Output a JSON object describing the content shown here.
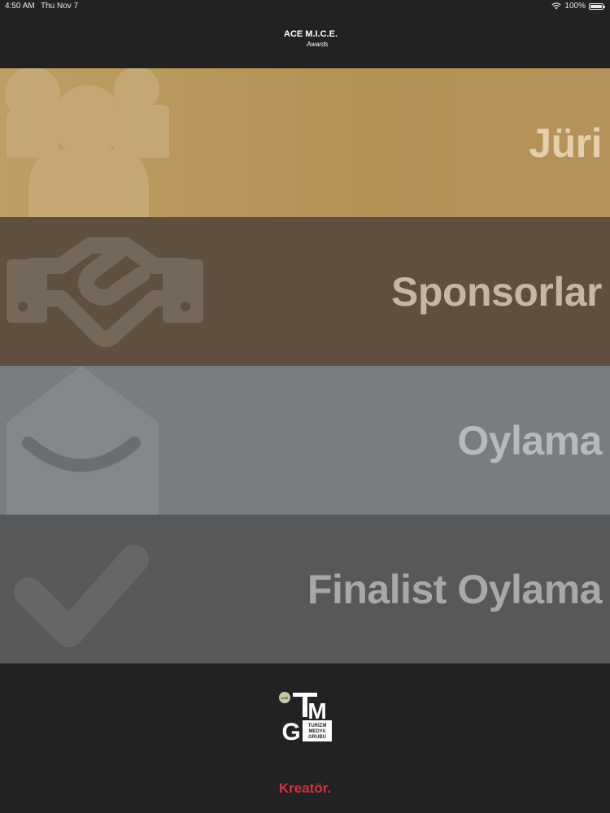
{
  "status_bar": {
    "time": "4:50 AM",
    "date": "Thu Nov 7",
    "battery": "100%",
    "battery_level": 1.0
  },
  "header": {
    "logo_line1": "ACE M.I.C.E.",
    "logo_line2": "Awards"
  },
  "menu": [
    {
      "label": "Jüri",
      "icon": "group-icon"
    },
    {
      "label": "Sponsorlar",
      "icon": "handshake-icon"
    },
    {
      "label": "Oylama",
      "icon": "envelope-icon"
    },
    {
      "label": "Finalist Oylama",
      "icon": "checkmark-icon"
    }
  ],
  "footer": {
    "tmg_letters": [
      "T",
      "M",
      "G"
    ],
    "tmg_text": [
      "TURİZM",
      "MEDYA",
      "GRUBU"
    ],
    "badge_text": "ACE",
    "credit": "Kreatör."
  },
  "colors": {
    "background": "#222224",
    "juri": "#b5965c",
    "sponsor": "#5e4f3f",
    "oylama": "#7a7d80",
    "finalist": "#575859",
    "credit": "#d0333b"
  }
}
